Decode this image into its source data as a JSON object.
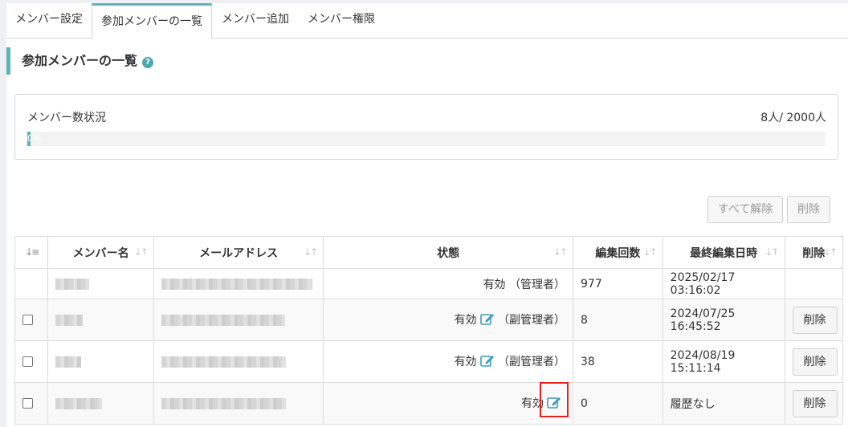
{
  "tabs": [
    {
      "label": "メンバー設定"
    },
    {
      "label": "参加メンバーの一覧",
      "active": true
    },
    {
      "label": "メンバー追加"
    },
    {
      "label": "メンバー権限"
    }
  ],
  "page_title": "参加メンバーの一覧",
  "help_icon": "?",
  "member_status": {
    "label": "メンバー数状況",
    "count": "8人/ 2000人",
    "progress_text": "0%",
    "progress_fraction": 0.004
  },
  "actions": {
    "release_all": "すべて解除",
    "delete": "削除"
  },
  "table": {
    "sort_icon": "↓↑",
    "select_sort_icon": "↓≡",
    "headers": [
      "メンバー名",
      "メールアドレス",
      "状態",
      "編集回数",
      "最終編集日時",
      "削除"
    ],
    "rows": [
      {
        "state": "有効",
        "role": "（管理者）",
        "edits": "977",
        "last_edit": "2025/02/17 03:16:02",
        "checkbox": false,
        "editable": false,
        "delete": ""
      },
      {
        "state": "有効",
        "role": "（副管理者）",
        "edits": "8",
        "last_edit": "2024/07/25 16:45:52",
        "checkbox": true,
        "editable": true,
        "delete": "削除"
      },
      {
        "state": "有効",
        "role": "（副管理者）",
        "edits": "38",
        "last_edit": "2024/08/19 15:11:14",
        "checkbox": true,
        "editable": true,
        "delete": "削除"
      },
      {
        "state": "有効",
        "role": "",
        "edits": "0",
        "last_edit": "履歴なし",
        "checkbox": true,
        "editable": true,
        "delete": "削除"
      }
    ]
  },
  "colors": {
    "accent": "#5fb3b8",
    "highlight": "#e3231b",
    "edit_icon": "#3a9dbd"
  }
}
